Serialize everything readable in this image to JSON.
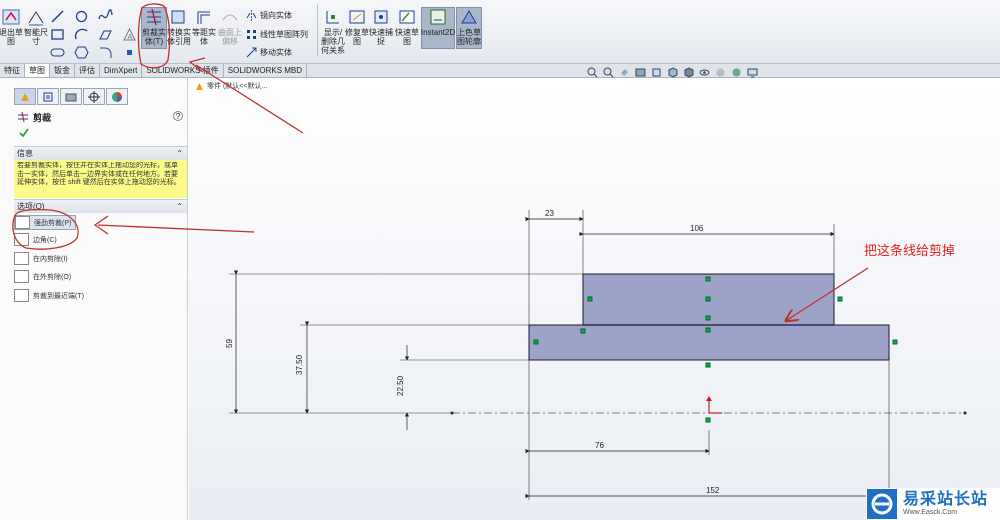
{
  "ribbon": {
    "exit_sketch_label": "退出草\n图",
    "smart_dim_label": "智能尺\n寸",
    "trim_label": "剪裁实\n体(T)",
    "convert_label": "转换实\n体引用",
    "offset_label": "等距实\n体",
    "surface_label": "曲面上\n偏移",
    "mirror_label": "镜向实体",
    "linear_pattern_label": "线性草图阵列",
    "move_label": "移动实体",
    "display_label": "显示/\n删除几\n何关系",
    "repair_label": "修复草\n图",
    "quick_snap_label": "快速捕\n捉",
    "rapid_sketch_label": "快速草\n图",
    "instant2d_label": "Instant2D",
    "shaded_label": "上色草\n图轮廓"
  },
  "tabs": [
    {
      "label": "特征",
      "active": false
    },
    {
      "label": "草图",
      "active": true
    },
    {
      "label": "钣金",
      "active": false
    },
    {
      "label": "评估",
      "active": false
    },
    {
      "label": "DimXpert",
      "active": false
    },
    {
      "label": "SOLIDWORKS 插件",
      "active": false
    },
    {
      "label": "SOLIDWORKS MBD",
      "active": false
    }
  ],
  "panel": {
    "title": "剪裁",
    "help_icon": "?",
    "info_header": "信息",
    "info_text": "若要剪裁实体，按住并在实体上拖动您的光标，或单击一实体，然后单击一边界实体或在任何地方。若要延伸实体，按住 shift 键然后在实体上拖动您的光标。",
    "options_header": "选项(O)",
    "options": [
      {
        "label": "强劲剪裁(P)",
        "selected": true
      },
      {
        "label": "边角(C)",
        "selected": false
      },
      {
        "label": "在内剪除(I)",
        "selected": false
      },
      {
        "label": "在外剪除(O)",
        "selected": false
      },
      {
        "label": "剪裁到最近端(T)",
        "selected": false
      }
    ]
  },
  "tree": {
    "label": "零件 (默认<<默认..."
  },
  "dimensions": {
    "d23": "23",
    "d106": "106",
    "d59": "59",
    "d37": "37.50",
    "d22": "22.50",
    "d76": "76",
    "d152": "152"
  },
  "annotation": {
    "text": "把这条线给剪掉",
    "color": "#e02020"
  },
  "colors": {
    "sketch_fill": "#9da3c8",
    "sketch_line": "#1a1a2e",
    "arrow": "#c0302a",
    "point": "#10b020"
  },
  "watermark": {
    "name": "易采站长站",
    "url": "Www.Easck.Com"
  }
}
